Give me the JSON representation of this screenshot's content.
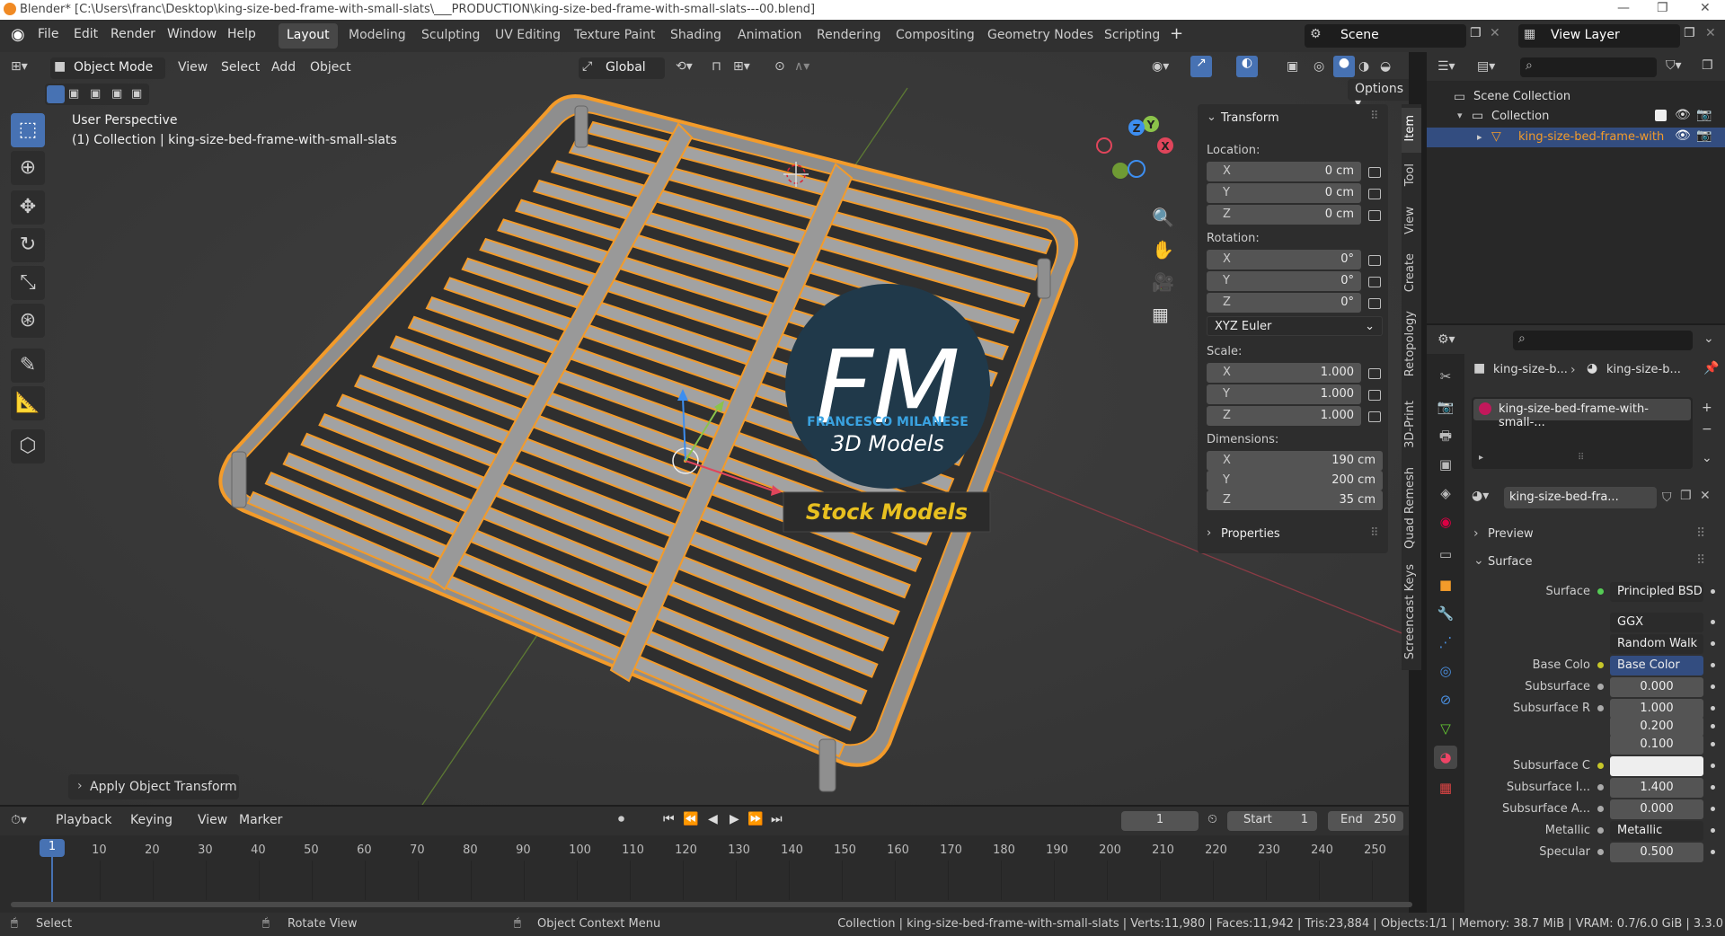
{
  "app": {
    "title": "Blender* [C:\\Users\\franc\\Desktop\\king-size-bed-frame-with-small-slats\\___PRODUCTION\\king-size-bed-frame-with-small-slats---00.blend]"
  },
  "menu": [
    "File",
    "Edit",
    "Render",
    "Window",
    "Help"
  ],
  "workspaces": [
    "Layout",
    "Modeling",
    "Sculpting",
    "UV Editing",
    "Texture Paint",
    "Shading",
    "Animation",
    "Rendering",
    "Compositing",
    "Geometry Nodes",
    "Scripting"
  ],
  "active_workspace": "Layout",
  "scene": "Scene",
  "view_layer": "View Layer",
  "viewport": {
    "mode": "Object Mode",
    "menus": [
      "View",
      "Select",
      "Add",
      "Object"
    ],
    "orientation": "Global",
    "options": "Options",
    "perspective": "User Perspective",
    "context": "(1) Collection | king-size-bed-frame-with-small-slats",
    "last_op": "Apply Object Transform",
    "logo_fm": "FM",
    "logo_name": "FRANCESCO MILANESE",
    "logo_sub": "3D Models",
    "logo_badge": "Stock Models",
    "gizmo": {
      "x": "X",
      "y": "Y",
      "z": "Z"
    }
  },
  "npanel": {
    "transform": "Transform",
    "location_label": "Location:",
    "location": [
      {
        "k": "X",
        "v": "0 cm"
      },
      {
        "k": "Y",
        "v": "0 cm"
      },
      {
        "k": "Z",
        "v": "0 cm"
      }
    ],
    "rotation_label": "Rotation:",
    "rotation": [
      {
        "k": "X",
        "v": "0°"
      },
      {
        "k": "Y",
        "v": "0°"
      },
      {
        "k": "Z",
        "v": "0°"
      }
    ],
    "rotation_mode": "XYZ Euler",
    "scale_label": "Scale:",
    "scale": [
      {
        "k": "X",
        "v": "1.000"
      },
      {
        "k": "Y",
        "v": "1.000"
      },
      {
        "k": "Z",
        "v": "1.000"
      }
    ],
    "dimensions_label": "Dimensions:",
    "dimensions": [
      {
        "k": "X",
        "v": "190 cm"
      },
      {
        "k": "Y",
        "v": "200 cm"
      },
      {
        "k": "Z",
        "v": "35 cm"
      }
    ],
    "properties": "Properties",
    "tabs": [
      "Item",
      "Tool",
      "View",
      "Create",
      "Retopology",
      "3D-Print",
      "Quad Remesh",
      "Screencast Keys"
    ]
  },
  "outliner": {
    "scene_collection": "Scene Collection",
    "collection": "Collection",
    "object": "king-size-bed-frame-with"
  },
  "properties": {
    "breadcrumb_a": "king-size-b...",
    "breadcrumb_b": "king-size-b...",
    "material_slot": "king-size-bed-frame-with-small-...",
    "material_name": "king-size-bed-fra...",
    "preview": "Preview",
    "surface_section": "Surface",
    "rows": [
      {
        "k": "Surface",
        "v": "Principled BSDF"
      },
      {
        "k": "",
        "v": "GGX"
      },
      {
        "k": "",
        "v": "Random Walk"
      },
      {
        "k": "Base Colo",
        "v": "Base Color"
      },
      {
        "k": "Subsurface",
        "v": "0.000"
      },
      {
        "k": "Subsurface R",
        "v": "1.000"
      },
      {
        "k": "",
        "v": "0.200"
      },
      {
        "k": "",
        "v": "0.100"
      },
      {
        "k": "Subsurface C",
        "v": ""
      },
      {
        "k": "Subsurface I...",
        "v": "1.400"
      },
      {
        "k": "Subsurface A...",
        "v": "0.000"
      },
      {
        "k": "Metallic",
        "v": "Metallic"
      },
      {
        "k": "Specular",
        "v": "0.500"
      }
    ]
  },
  "timeline": {
    "menus": [
      "Playback",
      "Keying",
      "View",
      "Marker"
    ],
    "current_frame": "1",
    "start_label": "Start",
    "start": "1",
    "end_label": "End",
    "end": "250",
    "ticks": [
      "1",
      "10",
      "20",
      "30",
      "40",
      "50",
      "60",
      "70",
      "80",
      "90",
      "100",
      "110",
      "120",
      "130",
      "140",
      "150",
      "160",
      "170",
      "180",
      "190",
      "200",
      "210",
      "220",
      "230",
      "240",
      "250"
    ]
  },
  "statusbar": {
    "select": "Select",
    "rotate": "Rotate View",
    "context": "Object Context Menu",
    "info": "Collection | king-size-bed-frame-with-small-slats | Verts:11,980 | Faces:11,942 | Tris:23,884 | Objects:1/1 | Memory: 38.7 MiB | VRAM: 0.7/6.0 GiB | 3.3.0"
  },
  "colors": {
    "accent": "#4772b3",
    "select_orange": "#f39b2a",
    "slat": "#9b9b9b",
    "axis_x": "#e0455b",
    "axis_y": "#8bc34a",
    "axis_z": "#3d8ef0"
  }
}
